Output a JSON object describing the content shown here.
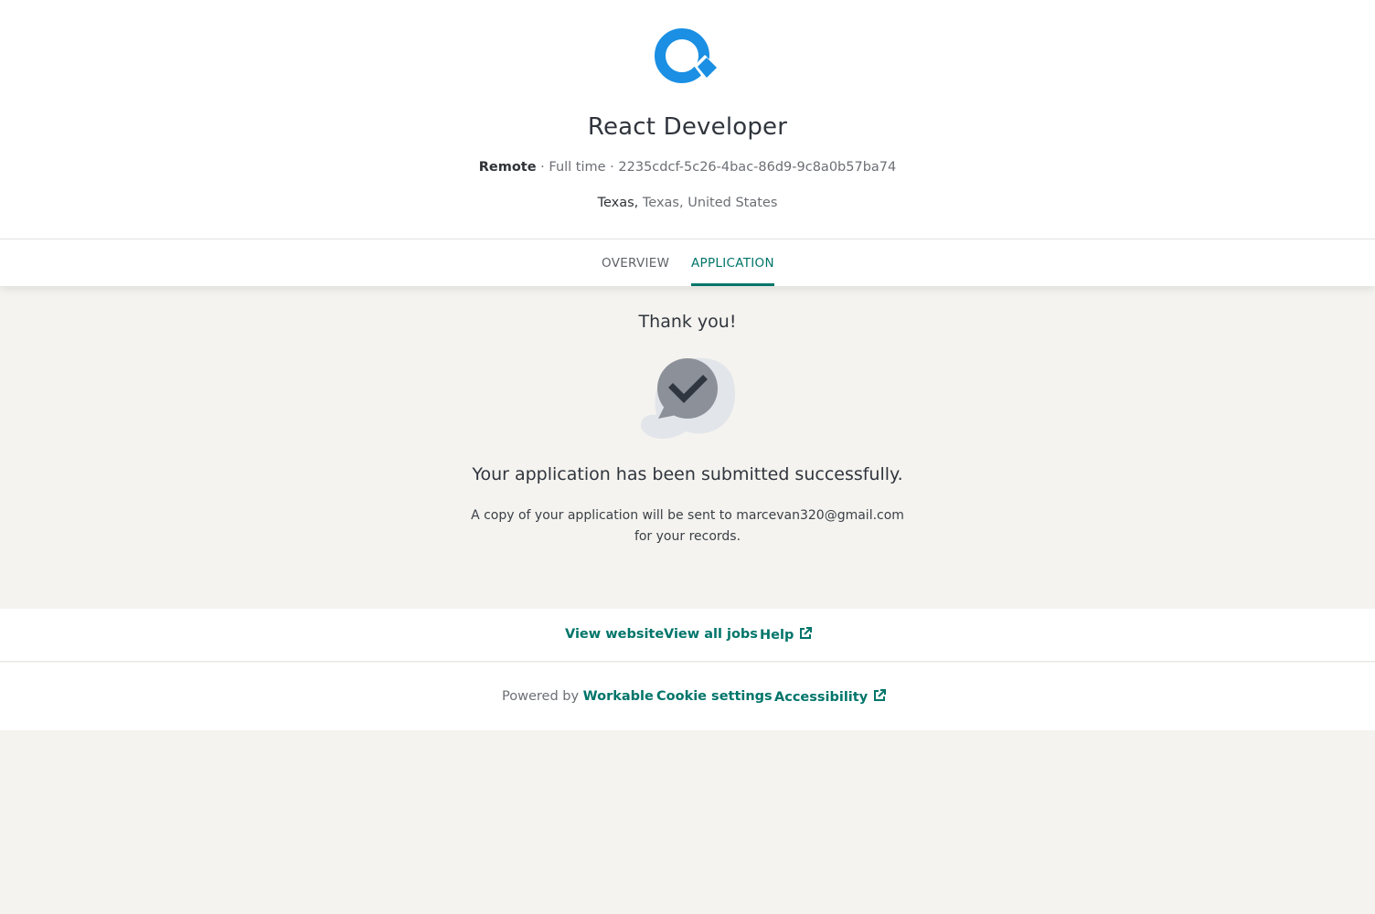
{
  "colors": {
    "brand_blue": "#1a8fe3",
    "accent_green": "#00756a",
    "page_bg": "#f4f3ef"
  },
  "header": {
    "job_title": "React Developer",
    "workplace": "Remote",
    "separator": " · ",
    "employment_type": "Full time",
    "job_code": "2235cdcf-5c26-4bac-86d9-9c8a0b57ba74",
    "location_city": "Texas,",
    "location_rest": " Texas, United States"
  },
  "tabs": {
    "overview": "OVERVIEW",
    "application": "APPLICATION"
  },
  "confirmation": {
    "heading": "Thank you!",
    "illustration_icon": "chat-check-icon",
    "title": "Your application has been submitted successfully.",
    "line1": "A copy of your application will be sent to marcevan320@gmail.com",
    "line2": "for your records."
  },
  "links": {
    "view_website": "View website",
    "view_all_jobs": "View all jobs",
    "help": "Help",
    "external_icon": "external-link-icon"
  },
  "footer": {
    "powered_by": "Powered by",
    "workable": "Workable",
    "cookie_settings": "Cookie settings",
    "accessibility": "Accessibility"
  }
}
